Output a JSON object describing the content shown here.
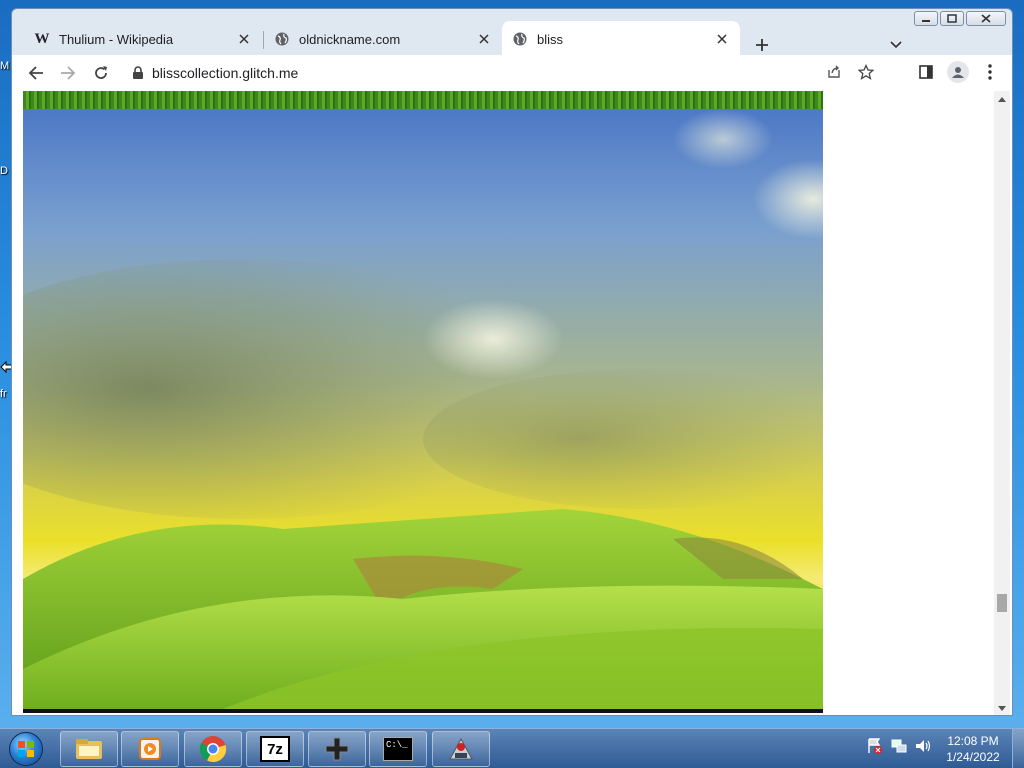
{
  "desktop": {
    "edge_labels": [
      "M",
      "D",
      "fr"
    ]
  },
  "browser": {
    "tabs": [
      {
        "title": "Thulium - Wikipedia",
        "favicon": "wikipedia-w-icon",
        "favicon_text": "W",
        "active": false
      },
      {
        "title": "oldnickname.com",
        "favicon": "globe-icon",
        "active": false
      },
      {
        "title": "bliss",
        "favicon": "globe-icon",
        "active": true
      }
    ],
    "url": "blisscollection.glitch.me"
  },
  "page": {
    "image_name": "bliss-wallpaper",
    "scroll_position_fraction": 0.86
  },
  "taskbar": {
    "apps": [
      {
        "name": "windows-explorer-icon"
      },
      {
        "name": "media-player-icon"
      },
      {
        "name": "chrome-icon"
      },
      {
        "name": "7zip-icon",
        "label": "7z"
      },
      {
        "name": "gamepad-icon"
      },
      {
        "name": "command-prompt-icon",
        "label": "C:\\_"
      },
      {
        "name": "java-app-icon"
      }
    ],
    "clock_time": "12:08 PM",
    "clock_date": "1/24/2022"
  },
  "colors": {
    "taskbar": "#2f5b95",
    "active_tab": "#ffffff",
    "tab_strip": "#dfe7f1"
  }
}
